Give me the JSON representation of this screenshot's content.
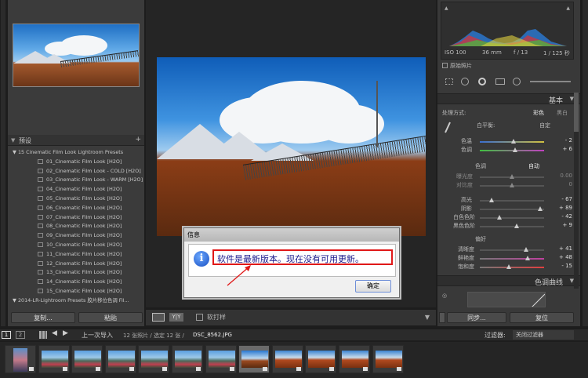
{
  "left_panel": {
    "presets_header": "预设",
    "presets_plus": "+",
    "presets": [
      {
        "label": "15 Cinematic Film Look Lightroom Presets",
        "folder": true
      },
      {
        "label": "01_Cinematic Film Look [H2O]"
      },
      {
        "label": "02_Cinematic Film Look - COLD [H2O]"
      },
      {
        "label": "03_Cinematic Film Look - WARM [H2O]"
      },
      {
        "label": "04_Cinematic Film Look [H2O]"
      },
      {
        "label": "05_Cinematic Film Look [H2O]"
      },
      {
        "label": "06_Cinematic Film Look [H2O]"
      },
      {
        "label": "07_Cinematic Film Look [H2O]"
      },
      {
        "label": "08_Cinematic Film Look [H2O]"
      },
      {
        "label": "09_Cinematic Film Look [H2O]"
      },
      {
        "label": "10_Cinematic Film Look [H2O]"
      },
      {
        "label": "11_Cinematic Film Look [H2O]"
      },
      {
        "label": "12_Cinematic Film Look [H2O]"
      },
      {
        "label": "13_Cinematic Film Look [H2O]"
      },
      {
        "label": "14_Cinematic Film Look [H2O]"
      },
      {
        "label": "15_Cinematic Film Look [H2O]"
      },
      {
        "label": "2014-LR-Lightroom Presets 胶片移位色调 Fil...",
        "folder": true
      }
    ],
    "copy_button": "复制...",
    "paste_button": "粘贴"
  },
  "toolbar": {
    "view_label": "Y|Y",
    "soft_proof_label": "软打样"
  },
  "dialog": {
    "title": "信息",
    "icon_glyph": "i",
    "message": "软件是最新版本。现在没有可用更新。",
    "ok_button": "确定"
  },
  "histogram": {
    "iso": "ISO 100",
    "focal": "36 mm",
    "aperture": "f / 13",
    "shutter": "1 / 125 秒",
    "original_photo": "原始照片"
  },
  "basic": {
    "header": "基本",
    "treatment_label": "处理方式:",
    "treatment_color": "彩色",
    "treatment_bw": "黑白",
    "wb_label": "白平衡:",
    "wb_value": "自定",
    "temp_label": "色温",
    "temp_value": "- 2",
    "tint_label": "色调",
    "tint_value": "+ 6",
    "tone_label": "色调",
    "auto_label": "自动",
    "exposure_label": "曝光度",
    "exposure_value": "0.00",
    "contrast_label": "对比度",
    "contrast_value": "0",
    "highlights_label": "高光",
    "highlights_value": "- 67",
    "shadows_label": "阴影",
    "shadows_value": "+ 89",
    "whites_label": "白色色阶",
    "whites_value": "- 42",
    "blacks_label": "黑色色阶",
    "blacks_value": "+ 9",
    "presence_label": "偏好",
    "clarity_label": "清晰度",
    "clarity_value": "+ 41",
    "vibrance_label": "鲜艳度",
    "vibrance_value": "+ 48",
    "saturation_label": "饱和度",
    "saturation_value": "- 15",
    "tone_curve_header": "色调曲线",
    "sync_button": "同步...",
    "reset_button": "复位"
  },
  "filmstrip": {
    "page1": "1",
    "page2": "2",
    "source": "上一次导入",
    "count": "12 张照片 / 选定 12 张 /",
    "filename": "DSC_8562.JPG",
    "filter_label": "过滤器:",
    "filter_value": "关闭过滤器"
  }
}
